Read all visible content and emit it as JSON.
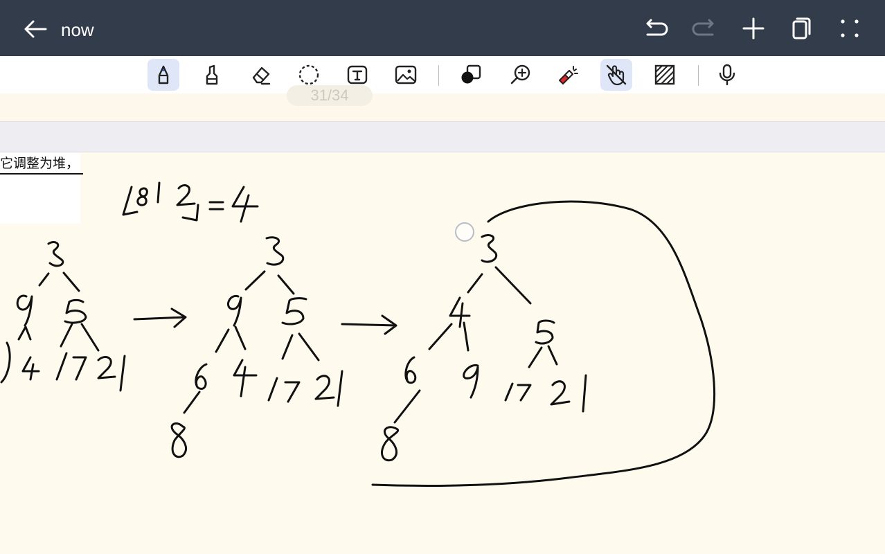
{
  "topbar": {
    "title": "now",
    "background": "#323c4a",
    "icons": [
      "back-arrow-icon",
      "undo-icon",
      "redo-icon",
      "add-page-icon",
      "pages-icon",
      "more-icon"
    ]
  },
  "toolbar": {
    "active_tool": "pen",
    "tools": [
      "pen",
      "highlighter",
      "eraser",
      "lasso",
      "text",
      "image",
      "shapes",
      "zoom",
      "laser-pointer",
      "touch-draw",
      "texture",
      "microphone"
    ],
    "active_color": "#dfe6f7"
  },
  "page": {
    "number_label": "31/34",
    "background": "#fefaee"
  },
  "note": {
    "chinese_text": "它调整为堆，"
  }
}
